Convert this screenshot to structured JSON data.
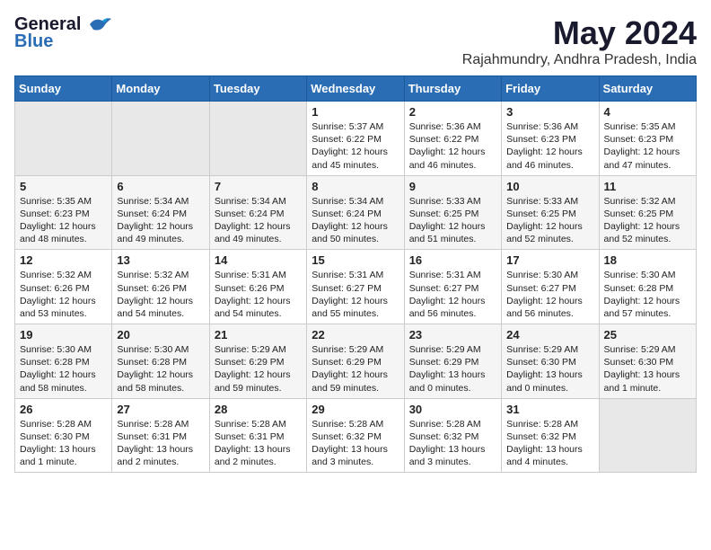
{
  "header": {
    "logo_general": "General",
    "logo_blue": "Blue",
    "month_year": "May 2024",
    "location": "Rajahmundry, Andhra Pradesh, India"
  },
  "days_of_week": [
    "Sunday",
    "Monday",
    "Tuesday",
    "Wednesday",
    "Thursday",
    "Friday",
    "Saturday"
  ],
  "weeks": [
    [
      {
        "day": "",
        "content": ""
      },
      {
        "day": "",
        "content": ""
      },
      {
        "day": "",
        "content": ""
      },
      {
        "day": "1",
        "content": "Sunrise: 5:37 AM\nSunset: 6:22 PM\nDaylight: 12 hours\nand 45 minutes."
      },
      {
        "day": "2",
        "content": "Sunrise: 5:36 AM\nSunset: 6:22 PM\nDaylight: 12 hours\nand 46 minutes."
      },
      {
        "day": "3",
        "content": "Sunrise: 5:36 AM\nSunset: 6:23 PM\nDaylight: 12 hours\nand 46 minutes."
      },
      {
        "day": "4",
        "content": "Sunrise: 5:35 AM\nSunset: 6:23 PM\nDaylight: 12 hours\nand 47 minutes."
      }
    ],
    [
      {
        "day": "5",
        "content": "Sunrise: 5:35 AM\nSunset: 6:23 PM\nDaylight: 12 hours\nand 48 minutes."
      },
      {
        "day": "6",
        "content": "Sunrise: 5:34 AM\nSunset: 6:24 PM\nDaylight: 12 hours\nand 49 minutes."
      },
      {
        "day": "7",
        "content": "Sunrise: 5:34 AM\nSunset: 6:24 PM\nDaylight: 12 hours\nand 49 minutes."
      },
      {
        "day": "8",
        "content": "Sunrise: 5:34 AM\nSunset: 6:24 PM\nDaylight: 12 hours\nand 50 minutes."
      },
      {
        "day": "9",
        "content": "Sunrise: 5:33 AM\nSunset: 6:25 PM\nDaylight: 12 hours\nand 51 minutes."
      },
      {
        "day": "10",
        "content": "Sunrise: 5:33 AM\nSunset: 6:25 PM\nDaylight: 12 hours\nand 52 minutes."
      },
      {
        "day": "11",
        "content": "Sunrise: 5:32 AM\nSunset: 6:25 PM\nDaylight: 12 hours\nand 52 minutes."
      }
    ],
    [
      {
        "day": "12",
        "content": "Sunrise: 5:32 AM\nSunset: 6:26 PM\nDaylight: 12 hours\nand 53 minutes."
      },
      {
        "day": "13",
        "content": "Sunrise: 5:32 AM\nSunset: 6:26 PM\nDaylight: 12 hours\nand 54 minutes."
      },
      {
        "day": "14",
        "content": "Sunrise: 5:31 AM\nSunset: 6:26 PM\nDaylight: 12 hours\nand 54 minutes."
      },
      {
        "day": "15",
        "content": "Sunrise: 5:31 AM\nSunset: 6:27 PM\nDaylight: 12 hours\nand 55 minutes."
      },
      {
        "day": "16",
        "content": "Sunrise: 5:31 AM\nSunset: 6:27 PM\nDaylight: 12 hours\nand 56 minutes."
      },
      {
        "day": "17",
        "content": "Sunrise: 5:30 AM\nSunset: 6:27 PM\nDaylight: 12 hours\nand 56 minutes."
      },
      {
        "day": "18",
        "content": "Sunrise: 5:30 AM\nSunset: 6:28 PM\nDaylight: 12 hours\nand 57 minutes."
      }
    ],
    [
      {
        "day": "19",
        "content": "Sunrise: 5:30 AM\nSunset: 6:28 PM\nDaylight: 12 hours\nand 58 minutes."
      },
      {
        "day": "20",
        "content": "Sunrise: 5:30 AM\nSunset: 6:28 PM\nDaylight: 12 hours\nand 58 minutes."
      },
      {
        "day": "21",
        "content": "Sunrise: 5:29 AM\nSunset: 6:29 PM\nDaylight: 12 hours\nand 59 minutes."
      },
      {
        "day": "22",
        "content": "Sunrise: 5:29 AM\nSunset: 6:29 PM\nDaylight: 12 hours\nand 59 minutes."
      },
      {
        "day": "23",
        "content": "Sunrise: 5:29 AM\nSunset: 6:29 PM\nDaylight: 13 hours\nand 0 minutes."
      },
      {
        "day": "24",
        "content": "Sunrise: 5:29 AM\nSunset: 6:30 PM\nDaylight: 13 hours\nand 0 minutes."
      },
      {
        "day": "25",
        "content": "Sunrise: 5:29 AM\nSunset: 6:30 PM\nDaylight: 13 hours\nand 1 minute."
      }
    ],
    [
      {
        "day": "26",
        "content": "Sunrise: 5:28 AM\nSunset: 6:30 PM\nDaylight: 13 hours\nand 1 minute."
      },
      {
        "day": "27",
        "content": "Sunrise: 5:28 AM\nSunset: 6:31 PM\nDaylight: 13 hours\nand 2 minutes."
      },
      {
        "day": "28",
        "content": "Sunrise: 5:28 AM\nSunset: 6:31 PM\nDaylight: 13 hours\nand 2 minutes."
      },
      {
        "day": "29",
        "content": "Sunrise: 5:28 AM\nSunset: 6:32 PM\nDaylight: 13 hours\nand 3 minutes."
      },
      {
        "day": "30",
        "content": "Sunrise: 5:28 AM\nSunset: 6:32 PM\nDaylight: 13 hours\nand 3 minutes."
      },
      {
        "day": "31",
        "content": "Sunrise: 5:28 AM\nSunset: 6:32 PM\nDaylight: 13 hours\nand 4 minutes."
      },
      {
        "day": "",
        "content": ""
      }
    ]
  ]
}
